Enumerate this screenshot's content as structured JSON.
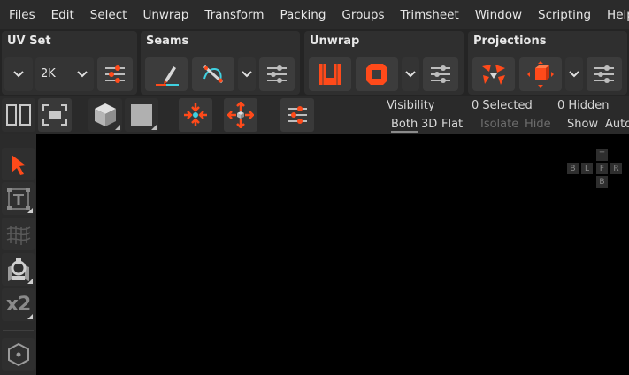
{
  "menu": [
    "Files",
    "Edit",
    "Select",
    "Unwrap",
    "Transform",
    "Packing",
    "Groups",
    "Trimsheet",
    "Window",
    "Scripting",
    "Help"
  ],
  "panels": {
    "uvset": {
      "title": "UV Set",
      "resolution": "2K"
    },
    "seams": {
      "title": "Seams"
    },
    "unwrap": {
      "title": "Unwrap"
    },
    "projections": {
      "title": "Projections"
    }
  },
  "toolbar": {
    "visibility_label": "Visibility",
    "visibility_options": [
      "Both",
      "3D",
      "Flat"
    ],
    "selected_label": "0 Selected",
    "isolate_label": "Isolate",
    "hide_label": "Hide",
    "hidden_label": "0 Hidden",
    "show_label": "Show",
    "auto_label": "Auto"
  },
  "navcube": {
    "top": "T",
    "back": "B",
    "left": "L",
    "front": "F",
    "right": "R",
    "bottom": "B"
  },
  "lefttools": {
    "multiplier": "x2"
  },
  "colors": {
    "accent": "#ff4a1a",
    "panel": "#2f2f2f",
    "menubar": "#2b2b2b",
    "cyan": "#3fd0e0"
  }
}
